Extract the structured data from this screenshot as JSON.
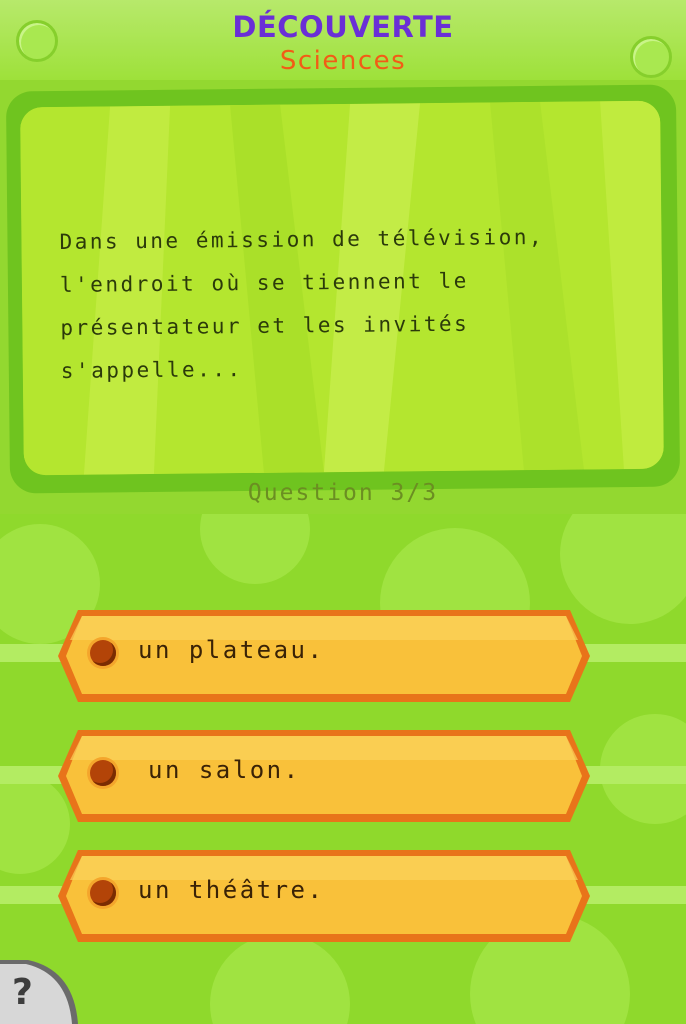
{
  "header": {
    "category": "DÉCOUVERTE",
    "subcategory": "Sciences"
  },
  "question": {
    "text": "Dans une émission de télévision,\nl'endroit où se tiennent le\nprésentateur et les invités\ns'appelle...",
    "counter": "Question 3/3"
  },
  "answers": [
    {
      "label": "un plateau."
    },
    {
      "label": "un salon."
    },
    {
      "label": "un théâtre."
    }
  ],
  "help": {
    "glyph": "?"
  },
  "colors": {
    "category": "#6a2fd6",
    "subcategory": "#f25c16",
    "answer_fill": "#f9c13a",
    "answer_border": "#e8741a",
    "background_green": "#8fd92c"
  }
}
